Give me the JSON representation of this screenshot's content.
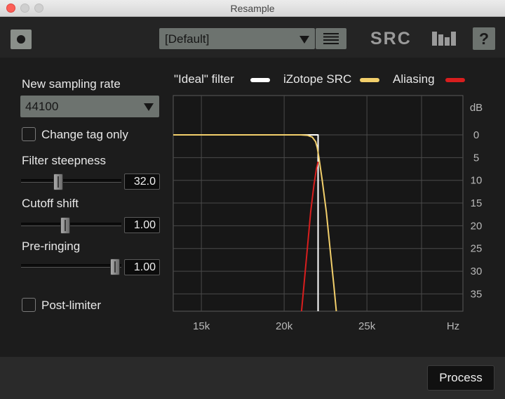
{
  "window": {
    "title": "Resample"
  },
  "header": {
    "preset_value": "[Default]",
    "logo_text": "SRC",
    "help_label": "?"
  },
  "left_panel": {
    "sampling_rate_label": "New sampling rate",
    "sampling_rate_value": "44100",
    "change_tag_label": "Change tag only",
    "change_tag_checked": false,
    "filter_steepness": {
      "label": "Filter steepness",
      "value": "32.0",
      "fraction": 0.37
    },
    "cutoff_shift": {
      "label": "Cutoff shift",
      "value": "1.00",
      "fraction": 0.44
    },
    "pre_ringing": {
      "label": "Pre-ringing",
      "value": "1.00",
      "fraction": 0.94
    },
    "post_limiter_label": "Post-limiter",
    "post_limiter_checked": false
  },
  "legend": [
    {
      "label": "\"Ideal\" filter",
      "color": "#ffffff"
    },
    {
      "label": "iZotope SRC",
      "color": "#f2cf6b"
    },
    {
      "label": "Aliasing",
      "color": "#d81e1e"
    }
  ],
  "chart_data": {
    "type": "line",
    "x_unit": "Hz",
    "y_unit": "dB",
    "x_ticks": [
      "15k",
      "20k",
      "25k"
    ],
    "x_tick_values": [
      15000,
      20000,
      25000
    ],
    "y_ticks": [
      "0",
      "5",
      "10",
      "15",
      "20",
      "25",
      "30",
      "35"
    ],
    "y_tick_values": [
      0,
      5,
      10,
      15,
      20,
      25,
      30,
      35
    ],
    "xlim": [
      13300,
      30800
    ],
    "ylim": [
      0,
      38.8
    ],
    "y_axis_position": "right",
    "grid": true,
    "series": [
      {
        "name": "\"Ideal\" filter",
        "color": "#ffffff",
        "points": [
          [
            13300,
            0
          ],
          [
            22050,
            0
          ],
          [
            22050,
            38.8
          ]
        ]
      },
      {
        "name": "iZotope SRC",
        "color": "#f2cf6b",
        "points": [
          [
            13300,
            0
          ],
          [
            21000,
            0
          ],
          [
            21400,
            0.1
          ],
          [
            21700,
            0.5
          ],
          [
            21900,
            1.5
          ],
          [
            22000,
            2.8
          ],
          [
            22100,
            5
          ],
          [
            22300,
            10
          ],
          [
            22550,
            17
          ],
          [
            22800,
            26
          ],
          [
            23000,
            33
          ],
          [
            23150,
            38.8
          ]
        ]
      },
      {
        "name": "Aliasing",
        "color": "#d81e1e",
        "points": [
          [
            21050,
            38.8
          ],
          [
            21200,
            33
          ],
          [
            21400,
            25
          ],
          [
            21600,
            17
          ],
          [
            21800,
            11
          ],
          [
            21950,
            7.5
          ],
          [
            22050,
            5.9
          ]
        ]
      }
    ]
  },
  "footer": {
    "process_label": "Process"
  }
}
